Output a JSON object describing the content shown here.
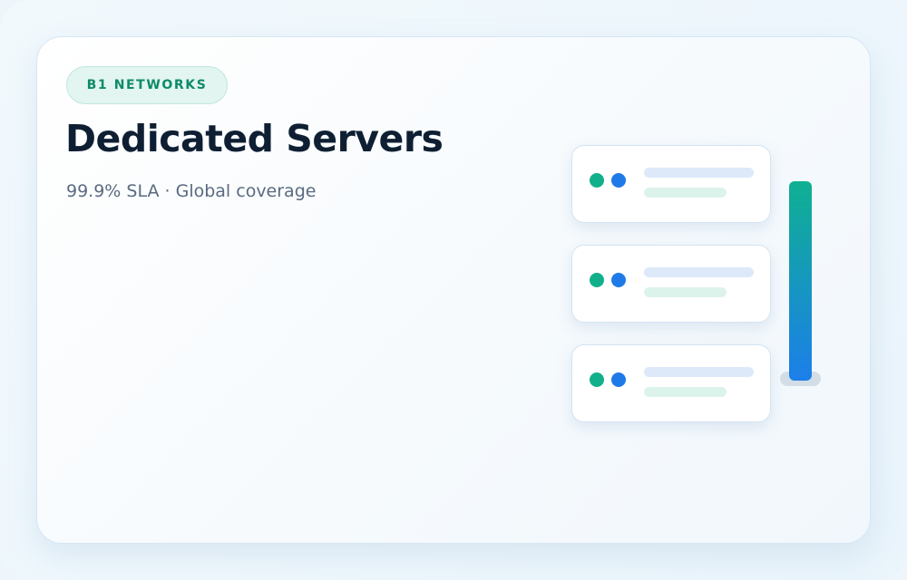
{
  "brand": {
    "badge_label": "B1 NETWORKS"
  },
  "hero": {
    "title": "Dedicated Servers",
    "subtitle": "99.9% SLA · Global coverage"
  },
  "illustration": {
    "server_count": 3,
    "status_dot_colors": [
      "#12b08a",
      "#1f7ae8"
    ],
    "rack_gradient": [
      "#0fb092",
      "#1c7fe9"
    ],
    "icons": [
      "server-icon",
      "status-dot-icon",
      "rack-icon"
    ]
  },
  "colors": {
    "accent_green": "#0f8a68",
    "badge_background": "#e2f5f1",
    "title": "#0f1f33",
    "subtitle": "#5a6b80"
  }
}
